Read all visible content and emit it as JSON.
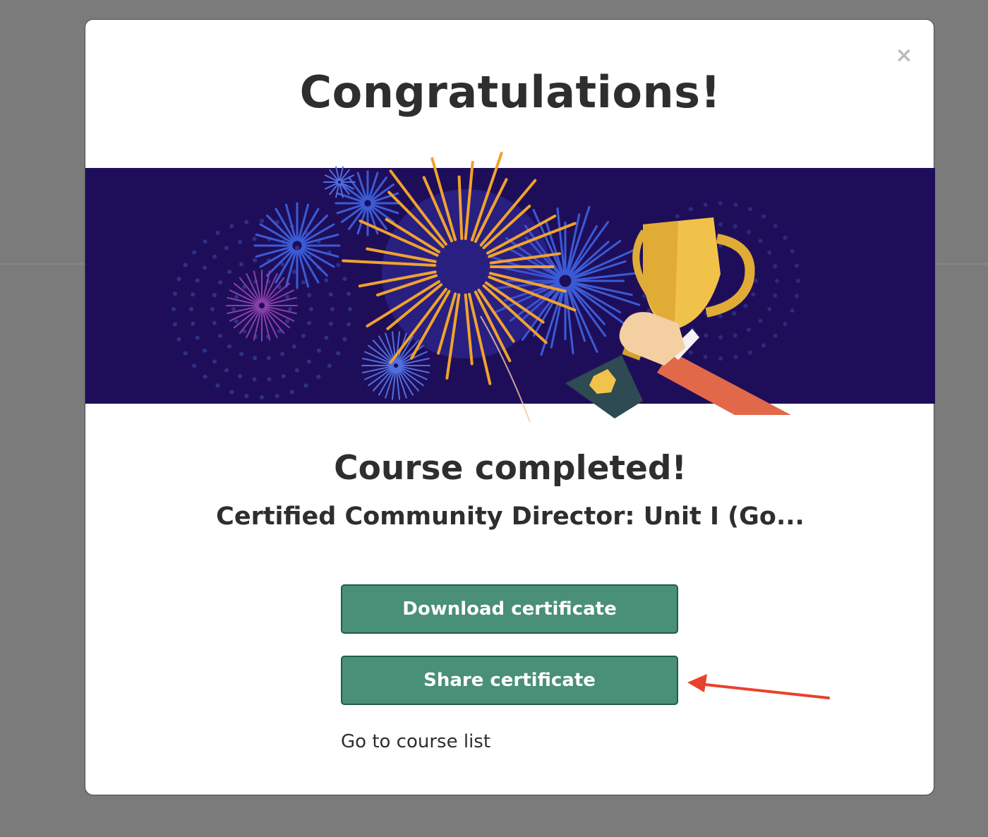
{
  "modal": {
    "close_symbol": "×",
    "title": "Congratulations!",
    "course_status": "Course completed!",
    "course_name": "Certified Community Director: Unit I (Go...",
    "buttons": {
      "download_label": "Download certificate",
      "share_label": "Share certificate"
    },
    "course_list_link": "Go to course list"
  },
  "colors": {
    "banner": "#1e0e5a",
    "button": "#4a8f78",
    "button_border": "#1f5d4a",
    "annotation_arrow": "#e8412c"
  },
  "icons": {
    "close": "close-icon",
    "trophy": "trophy-icon",
    "arrow": "arrow-annotation-icon"
  }
}
